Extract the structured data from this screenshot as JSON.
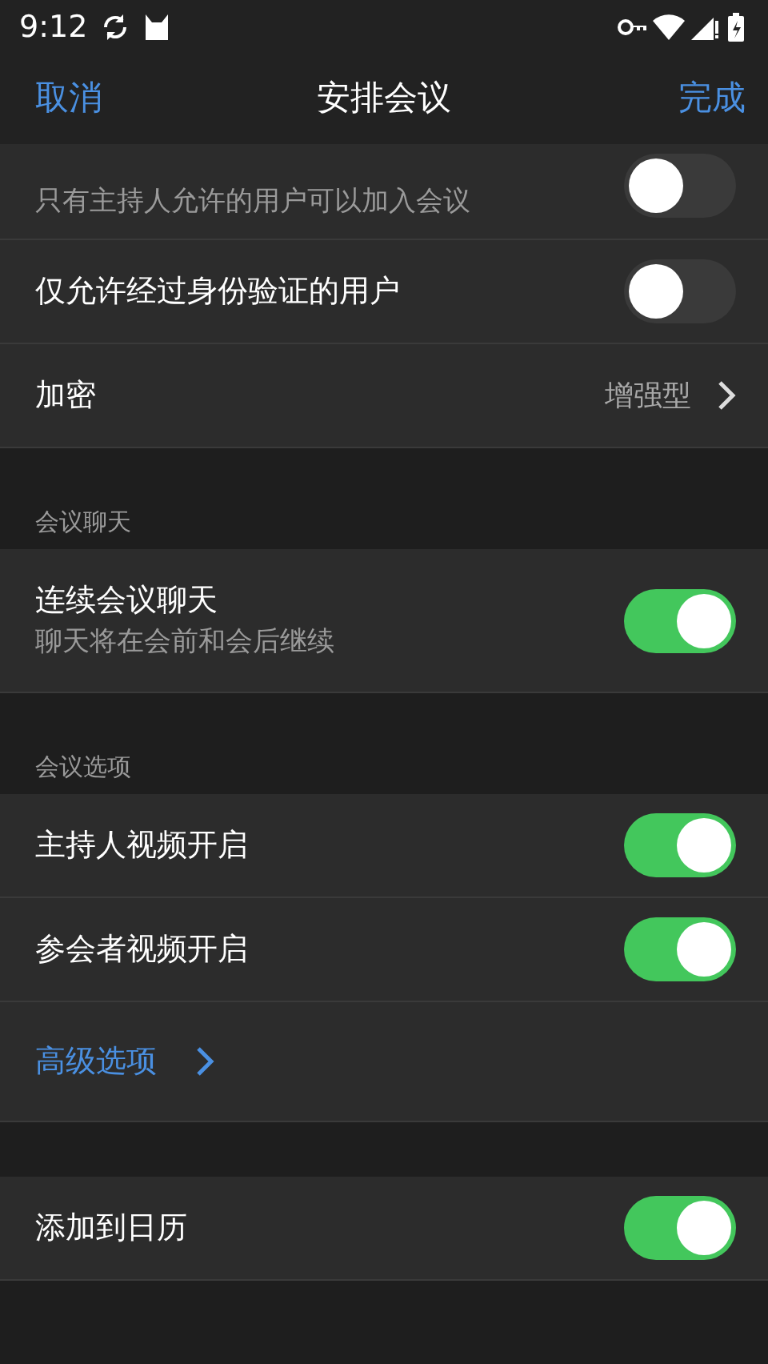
{
  "status_bar": {
    "time": "9:12"
  },
  "header": {
    "cancel": "取消",
    "title": "安排会议",
    "done": "完成"
  },
  "sections": [
    {
      "kind": "plain_top",
      "rows": [
        {
          "kind": "toggle",
          "subtitle": "只有主持人允许的用户可以加入会议",
          "on": false
        },
        {
          "kind": "toggle",
          "title": "仅允许经过身份验证的用户",
          "on": false
        },
        {
          "kind": "value",
          "title": "加密",
          "value": "增强型"
        }
      ]
    },
    {
      "kind": "headed",
      "header": "会议聊天",
      "rows": [
        {
          "kind": "toggle",
          "title": "连续会议聊天",
          "subtitle": "聊天将在会前和会后继续",
          "on": true
        }
      ]
    },
    {
      "kind": "headed",
      "header": "会议选项",
      "rows": [
        {
          "kind": "toggle",
          "title": "主持人视频开启",
          "on": true
        },
        {
          "kind": "toggle",
          "title": "参会者视频开启",
          "on": true
        },
        {
          "kind": "link",
          "title": "高级选项"
        }
      ]
    },
    {
      "kind": "spaced",
      "rows": [
        {
          "kind": "toggle",
          "title": "添加到日历",
          "on": true
        }
      ]
    }
  ]
}
